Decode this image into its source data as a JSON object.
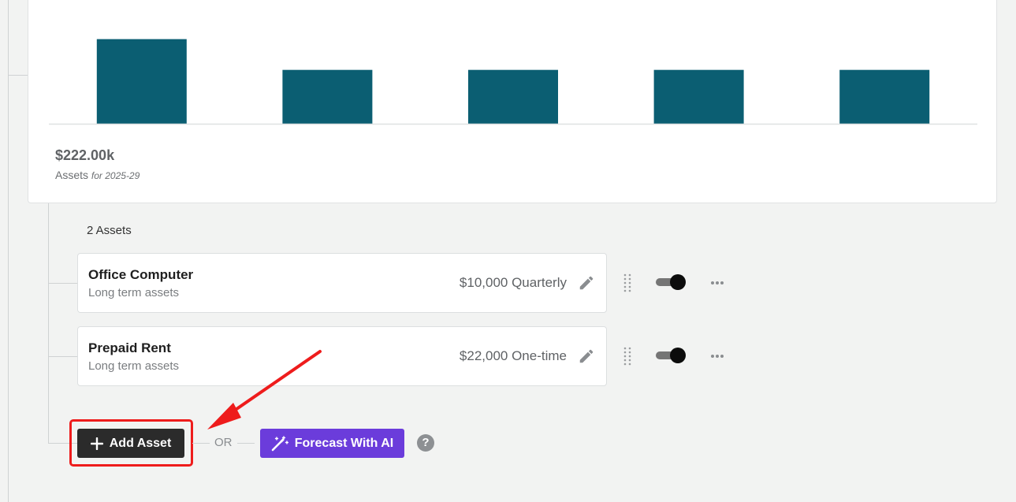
{
  "chart_data": {
    "type": "bar",
    "categories": [],
    "values": [
      22,
      14,
      14,
      14,
      14
    ],
    "ylim": [
      0,
      25
    ],
    "grid": false,
    "bar_color": "#0b5e72"
  },
  "summary": {
    "total": "$222.00k",
    "caption": "Assets",
    "period": "for 2025-29"
  },
  "assets": {
    "count_label": "2 Assets",
    "items": [
      {
        "name": "Office Computer",
        "category": "Long term assets",
        "amount": "$10,000 Quarterly",
        "enabled": true
      },
      {
        "name": "Prepaid Rent",
        "category": "Long term assets",
        "amount": "$22,000 One-time",
        "enabled": true
      }
    ]
  },
  "actions": {
    "add_label": "Add Asset",
    "or_label": "OR",
    "ai_label": "Forecast With AI",
    "help_label": "?"
  },
  "colors": {
    "accent_ai": "#6b3cdb",
    "highlight": "#ee1c1c",
    "bar": "#0b5e72"
  }
}
